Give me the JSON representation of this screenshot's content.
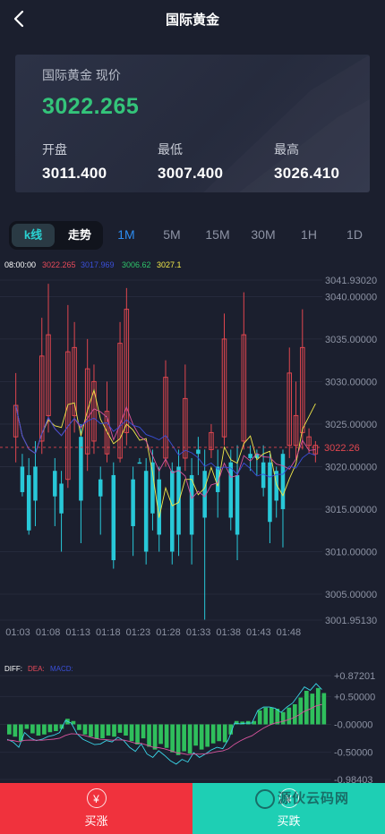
{
  "header": {
    "title": "国际黄金"
  },
  "summary": {
    "label": "国际黄金 现价",
    "price": "3022.265",
    "open_label": "开盘",
    "open": "3011.400",
    "low_label": "最低",
    "low": "3007.400",
    "high_label": "最高",
    "high": "3026.410"
  },
  "tabs": {
    "kline": "k线",
    "trend": "走势",
    "periods": [
      "1M",
      "5M",
      "15M",
      "30M",
      "1H",
      "1D"
    ],
    "active_period": "1M"
  },
  "legend": {
    "time": "08:00:00",
    "v1": "3022.265",
    "v2": "3017.969",
    "v3": "3006.62",
    "v4": "3027.1"
  },
  "macd_legend": {
    "diff": "DIFF:",
    "dea": "DEA:",
    "macd": "MACD:"
  },
  "chart_data": [
    {
      "type": "candlestick",
      "y_ticks": [
        "3041.93020",
        "3040.00000",
        "3035.00000",
        "3030.00000",
        "3025.00000",
        "3020.00000",
        "3015.00000",
        "3010.00000",
        "3005.00000",
        "3001.95130"
      ],
      "y_tick_values": [
        3041.9302,
        3040,
        3035,
        3030,
        3025,
        3020,
        3015,
        3010,
        3005,
        3001.9513
      ],
      "ylim": [
        3001.9513,
        3041.9302
      ],
      "x_ticks": [
        "01:03",
        "01:08",
        "01:13",
        "01:18",
        "01:23",
        "01:28",
        "01:33",
        "01:38",
        "01:43",
        "01:48"
      ],
      "last_price_label": "3022.26",
      "last_price": 3022.265,
      "candles": [
        [
          3023.5,
          3027.2,
          3020.5,
          3031.0,
          "up"
        ],
        [
          3017.0,
          3020.0,
          3016.5,
          3021.5,
          "down"
        ],
        [
          3012.5,
          3019.0,
          3012.0,
          3021.0,
          "down"
        ],
        [
          3016.0,
          3020.0,
          3013.0,
          3023.0,
          "down"
        ],
        [
          3023.0,
          3033.0,
          3021.5,
          3037.5,
          "up"
        ],
        [
          3026.0,
          3035.5,
          3024.0,
          3041.5,
          "up"
        ],
        [
          3019.5,
          3016.5,
          3013.0,
          3021.0,
          "down"
        ],
        [
          3014.5,
          3018.0,
          3010.0,
          3019.5,
          "down"
        ],
        [
          3018.5,
          3033.5,
          3017.5,
          3039.0,
          "up"
        ],
        [
          3026.0,
          3034.0,
          3024.0,
          3037.0,
          "up"
        ],
        [
          3023.5,
          3016.0,
          3011.0,
          3025.0,
          "down"
        ],
        [
          3021.5,
          3031.5,
          3019.5,
          3035.0,
          "up"
        ],
        [
          3023.0,
          3030.0,
          3021.5,
          3032.0,
          "up"
        ],
        [
          3018.5,
          3016.5,
          3012.0,
          3020.0,
          "down"
        ],
        [
          3021.5,
          3026.5,
          3020.5,
          3030.0,
          "up"
        ],
        [
          3019.0,
          3009.0,
          3008.0,
          3020.5,
          "down"
        ],
        [
          3021.0,
          3034.5,
          3020.5,
          3037.0,
          "up"
        ],
        [
          3024.0,
          3038.5,
          3022.5,
          3041.0,
          "up"
        ],
        [
          3018.5,
          3013.0,
          3009.5,
          3020.0,
          "down"
        ],
        [
          3020.5,
          3020.5,
          3020.5,
          3021.0,
          "down"
        ],
        [
          3019.5,
          3010.0,
          3008.5,
          3021.0,
          "down"
        ],
        [
          3020.5,
          3014.5,
          3012.5,
          3022.0,
          "down"
        ],
        [
          3018.5,
          3012.0,
          3010.0,
          3020.0,
          "down"
        ],
        [
          3021.0,
          3030.5,
          3020.0,
          3032.5,
          "up"
        ],
        [
          3019.5,
          3010.0,
          3008.5,
          3020.5,
          "down"
        ],
        [
          3020.0,
          3012.0,
          3009.5,
          3022.0,
          "down"
        ],
        [
          3021.0,
          3028.0,
          3019.5,
          3032.0,
          "up"
        ],
        [
          3019.0,
          3012.0,
          3008.5,
          3021.0,
          "down"
        ],
        [
          3022.0,
          3021.5,
          3019.0,
          3023.5,
          "down"
        ],
        [
          3019.5,
          3014.0,
          3002.0,
          3022.0,
          "down"
        ],
        [
          3022.0,
          3024.0,
          3021.0,
          3025.0,
          "up"
        ],
        [
          3020.0,
          3017.0,
          3014.0,
          3022.0,
          "down"
        ],
        [
          3023.5,
          3035.0,
          3022.5,
          3038.0,
          "up"
        ],
        [
          3020.5,
          3014.0,
          3012.5,
          3022.0,
          "down"
        ],
        [
          3019.0,
          3012.0,
          3009.0,
          3022.5,
          "down"
        ],
        [
          3023.0,
          3035.5,
          3022.0,
          3040.5,
          "up"
        ],
        [
          3021.0,
          3021.5,
          3019.5,
          3022.5,
          "down"
        ],
        [
          3021.5,
          3021.0,
          3019.0,
          3022.0,
          "down"
        ],
        [
          3020.5,
          3017.5,
          3016.5,
          3022.5,
          "down"
        ],
        [
          3020.5,
          3013.5,
          3011.0,
          3021.5,
          "down"
        ],
        [
          3019.5,
          3016.0,
          3014.0,
          3020.0,
          "down"
        ],
        [
          3021.5,
          3015.0,
          3010.5,
          3022.0,
          "down"
        ],
        [
          3022.5,
          3031.0,
          3021.0,
          3034.0,
          "up"
        ],
        [
          3022.5,
          3026.0,
          3021.0,
          3030.0,
          "up"
        ],
        [
          3024.0,
          3034.0,
          3022.0,
          3038.5,
          "up"
        ],
        [
          3022.5,
          3023.5,
          3021.5,
          3024.5,
          "up"
        ],
        [
          3021.5,
          3022.5,
          3020.5,
          3023.0,
          "up"
        ]
      ]
    },
    {
      "type": "bar",
      "y_ticks": [
        "+0.87201",
        "+0.50000",
        "-0.00000",
        "-0.50000",
        "-0.98403"
      ],
      "y_tick_values": [
        0.87201,
        0.5,
        0,
        -0.5,
        -0.98403
      ],
      "ylim": [
        -0.98403,
        0.87201
      ],
      "series": [
        {
          "values": [
            -0.18,
            -0.22,
            -0.3,
            -0.08,
            -0.16,
            -0.2,
            -0.18,
            -0.14,
            -0.12,
            -0.08,
            0.1,
            0.06,
            -0.1,
            -0.18,
            -0.22,
            -0.26,
            -0.25,
            -0.2,
            -0.22,
            -0.15,
            -0.2,
            -0.3,
            -0.36,
            -0.25,
            -0.4,
            -0.45,
            -0.35,
            -0.42,
            -0.5,
            -0.55,
            -0.48,
            -0.52,
            -0.38,
            -0.45,
            -0.4,
            -0.34,
            -0.3,
            -0.32,
            -0.18,
            0.06,
            0.05,
            0.06,
            0.06,
            0.25,
            0.3,
            0.3,
            0.28,
            0.22,
            0.3,
            0.36,
            0.48,
            0.6,
            0.55,
            0.65,
            0.56
          ]
        }
      ]
    }
  ],
  "actions": {
    "buy": "买涨",
    "sell": "买跌",
    "buy_icon": "¥",
    "sell_icon": "¥"
  },
  "watermark": "源伙云码网"
}
